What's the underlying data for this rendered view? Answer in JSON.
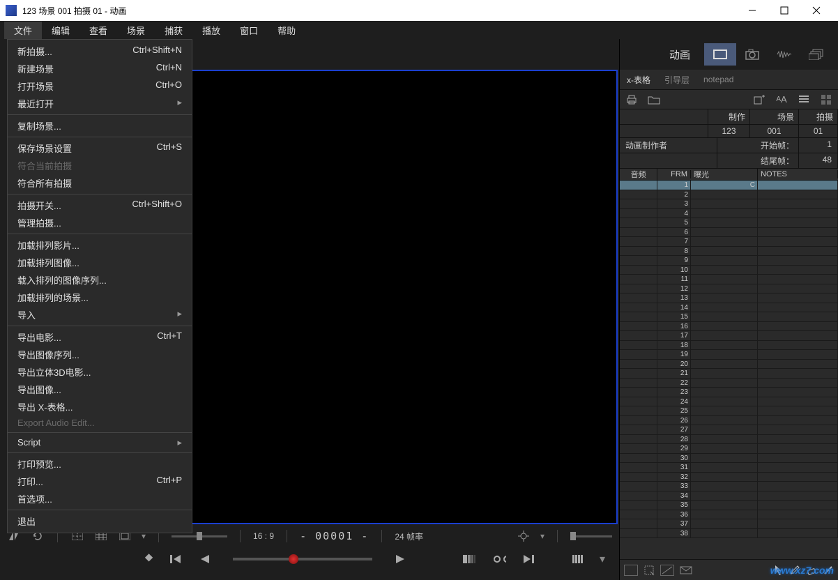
{
  "window": {
    "title": "123  场景 001  拍摄 01 - 动画"
  },
  "menubar": {
    "items": [
      "文件",
      "编辑",
      "查看",
      "场景",
      "捕获",
      "播放",
      "窗口",
      "帮助"
    ],
    "active": 0
  },
  "file_menu": [
    {
      "label": "新拍摄...",
      "shortcut": "Ctrl+Shift+N"
    },
    {
      "label": "新建场景",
      "shortcut": "Ctrl+N"
    },
    {
      "label": "打开场景",
      "shortcut": "Ctrl+O"
    },
    {
      "label": "最近打开",
      "submenu": true
    },
    {
      "sep": true
    },
    {
      "label": "复制场景..."
    },
    {
      "sep": true
    },
    {
      "label": "保存场景设置",
      "shortcut": "Ctrl+S"
    },
    {
      "label": "符合当前拍摄",
      "disabled": true
    },
    {
      "label": "符合所有拍摄"
    },
    {
      "sep": true
    },
    {
      "label": "拍摄开关...",
      "shortcut": "Ctrl+Shift+O"
    },
    {
      "label": "管理拍摄..."
    },
    {
      "sep": true
    },
    {
      "label": "加载排列影片..."
    },
    {
      "label": "加载排列图像..."
    },
    {
      "label": "载入排列的图像序列..."
    },
    {
      "label": "加载排列的场景..."
    },
    {
      "label": "导入",
      "submenu": true
    },
    {
      "sep": true
    },
    {
      "label": "导出电影...",
      "shortcut": "Ctrl+T"
    },
    {
      "label": "导出图像序列..."
    },
    {
      "label": "导出立体3D电影..."
    },
    {
      "label": "导出图像..."
    },
    {
      "label": "导出 X-表格..."
    },
    {
      "label": "Export Audio Edit...",
      "disabled": true
    },
    {
      "sep": true
    },
    {
      "label": "Script",
      "submenu": true
    },
    {
      "sep": true
    },
    {
      "label": "打印预览..."
    },
    {
      "label": "打印...",
      "shortcut": "Ctrl+P"
    },
    {
      "label": "首选项..."
    },
    {
      "sep": true
    },
    {
      "label": "退出"
    }
  ],
  "status": {
    "aspect": "16 : 9",
    "frame": "- 00001 -",
    "fps": "24 帧率"
  },
  "right_panel": {
    "mode_label": "动画",
    "sub_tabs": [
      "x-表格",
      "引导层",
      "notepad"
    ],
    "headers": {
      "make": "制作",
      "scene": "场景",
      "take": "拍摄"
    },
    "values": {
      "make": "123",
      "scene": "001",
      "take": "01"
    },
    "animator_label": "动画制作者",
    "start_label": "开始帧：",
    "start_val": "1",
    "end_label": "结尾帧：",
    "end_val": "48",
    "cols": {
      "audio": "音频",
      "frm": "FRM",
      "exp": "曝光",
      "notes": "NOTES"
    },
    "first_exp": "C",
    "frame_count": 38
  },
  "watermark": "www.xz7.com"
}
